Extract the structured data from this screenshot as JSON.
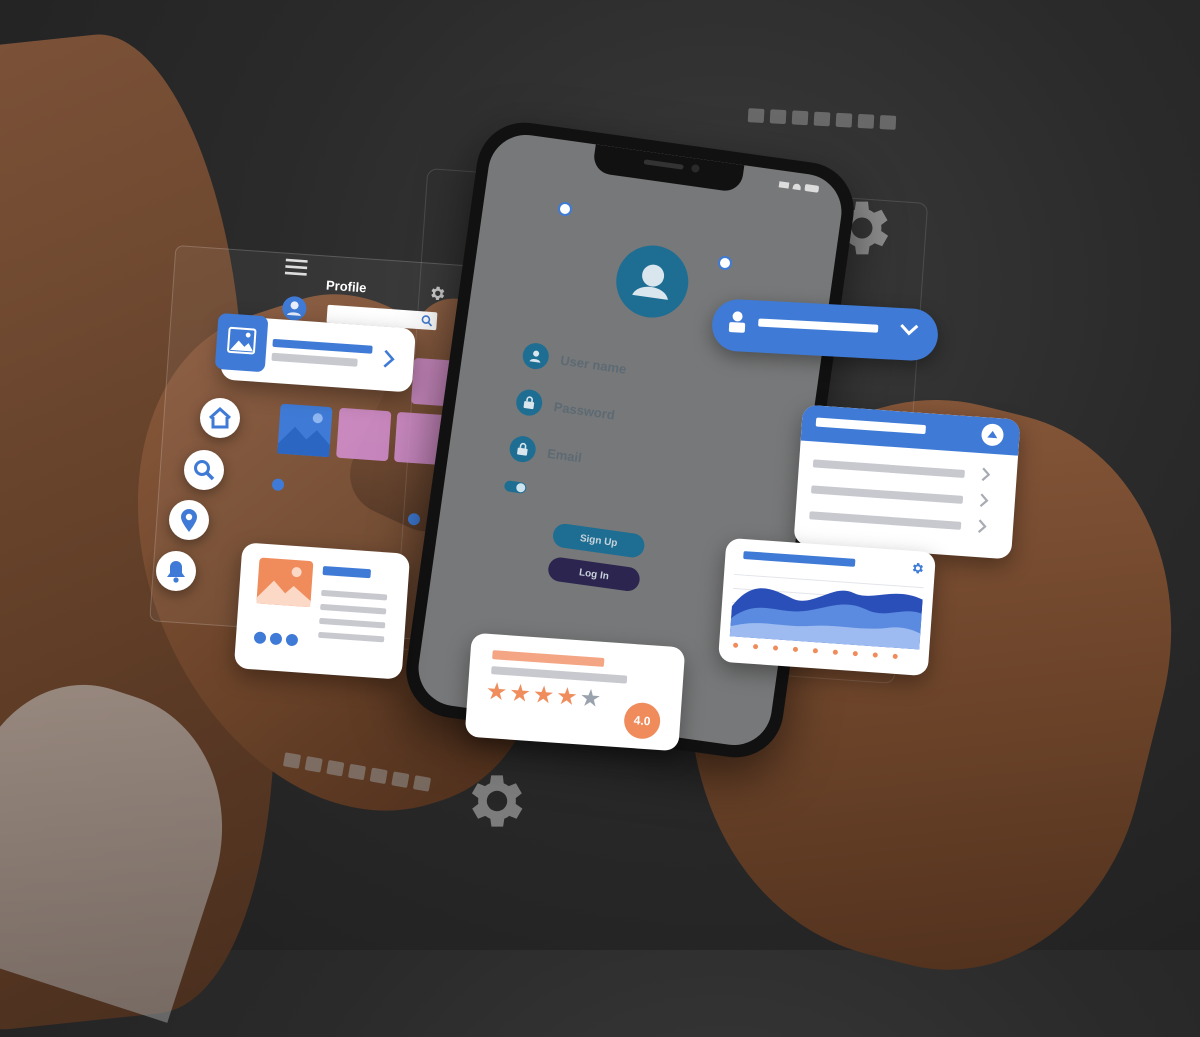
{
  "phone": {
    "signal_icons": [
      "signal-icon",
      "wifi-icon",
      "battery-icon"
    ],
    "fields": [
      {
        "label": "User name",
        "icon": "user-icon"
      },
      {
        "label": "Password",
        "icon": "lock-icon"
      },
      {
        "label": "Email",
        "icon": "lock-icon"
      }
    ],
    "signup_label": "Sign Up",
    "login_label": "Log In",
    "colors": {
      "accent": "#1e6e93",
      "signup_bg": "#1e6e93",
      "login_bg": "#2b2550",
      "screen": "#777879"
    }
  },
  "profile_panel": {
    "title": "Profile",
    "icons": [
      "menu-icon",
      "settings-icon",
      "avatar-icon",
      "search-icon"
    ]
  },
  "side_icons": [
    "home-icon",
    "search-icon",
    "location-pin-icon",
    "bell-icon"
  ],
  "rating_card": {
    "stars": 4,
    "max_stars": 5,
    "badge": "4.0",
    "colors": {
      "star": "#ef8d5c",
      "badge": "#ef8d5c"
    }
  },
  "colors": {
    "primary_blue": "#3f7bd6",
    "card_bg": "#ffffff",
    "tile_pink": "#d692d6"
  }
}
